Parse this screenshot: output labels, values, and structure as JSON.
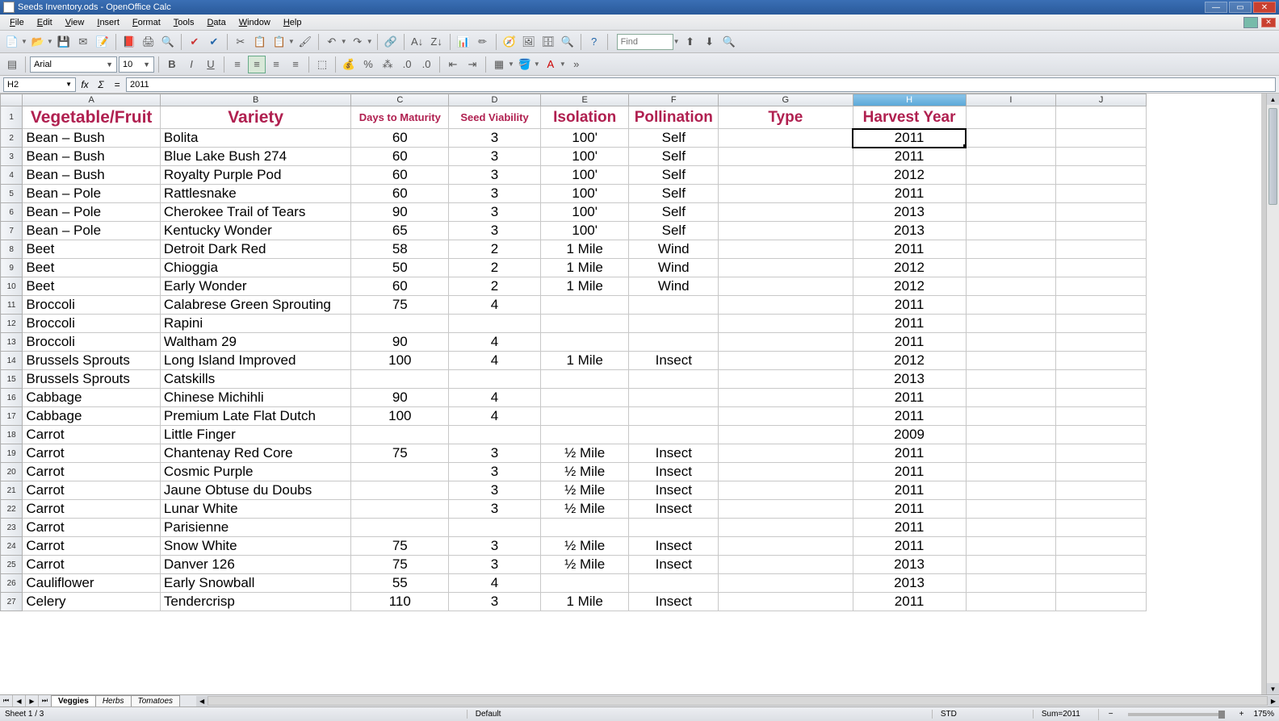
{
  "window": {
    "title": "Seeds Inventory.ods - OpenOffice Calc"
  },
  "menu": [
    "File",
    "Edit",
    "View",
    "Insert",
    "Format",
    "Tools",
    "Data",
    "Window",
    "Help"
  ],
  "format_bar": {
    "font_name": "Arial",
    "font_size": "10"
  },
  "formula": {
    "name_box": "H2",
    "content": "2011"
  },
  "find": {
    "placeholder": "Find"
  },
  "columns": [
    "A",
    "B",
    "C",
    "D",
    "E",
    "F",
    "G",
    "H",
    "I",
    "J"
  ],
  "selected_col": "H",
  "headers": {
    "A": "Vegetable/Fruit",
    "B": "Variety",
    "C": "Days to Maturity",
    "D": "Seed Viability",
    "E": "Isolation",
    "F": "Pollination",
    "G": "Type",
    "H": "Harvest Year"
  },
  "rows": [
    {
      "n": 2,
      "A": "Bean – Bush",
      "B": "Bolita",
      "C": "60",
      "D": "3",
      "E": "100'",
      "F": "Self",
      "G": "",
      "H": "2011"
    },
    {
      "n": 3,
      "A": "Bean – Bush",
      "B": "Blue Lake Bush 274",
      "C": "60",
      "D": "3",
      "E": "100'",
      "F": "Self",
      "G": "",
      "H": "2011"
    },
    {
      "n": 4,
      "A": "Bean – Bush",
      "B": "Royalty Purple Pod",
      "C": "60",
      "D": "3",
      "E": "100'",
      "F": "Self",
      "G": "",
      "H": "2012"
    },
    {
      "n": 5,
      "A": "Bean – Pole",
      "B": "Rattlesnake",
      "C": "60",
      "D": "3",
      "E": "100'",
      "F": "Self",
      "G": "",
      "H": "2011"
    },
    {
      "n": 6,
      "A": "Bean – Pole",
      "B": "Cherokee Trail of Tears",
      "C": "90",
      "D": "3",
      "E": "100'",
      "F": "Self",
      "G": "",
      "H": "2013"
    },
    {
      "n": 7,
      "A": "Bean – Pole",
      "B": "Kentucky Wonder",
      "C": "65",
      "D": "3",
      "E": "100'",
      "F": "Self",
      "G": "",
      "H": "2013"
    },
    {
      "n": 8,
      "A": "Beet",
      "B": "Detroit Dark Red",
      "C": "58",
      "D": "2",
      "E": "1 Mile",
      "F": "Wind",
      "G": "",
      "H": "2011"
    },
    {
      "n": 9,
      "A": "Beet",
      "B": "Chioggia",
      "C": "50",
      "D": "2",
      "E": "1 Mile",
      "F": "Wind",
      "G": "",
      "H": "2012"
    },
    {
      "n": 10,
      "A": "Beet",
      "B": "Early Wonder",
      "C": "60",
      "D": "2",
      "E": "1 Mile",
      "F": "Wind",
      "G": "",
      "H": "2012"
    },
    {
      "n": 11,
      "A": "Broccoli",
      "B": "Calabrese Green Sprouting",
      "C": "75",
      "D": "4",
      "E": "",
      "F": "",
      "G": "",
      "H": "2011"
    },
    {
      "n": 12,
      "A": "Broccoli",
      "B": "Rapini",
      "C": "",
      "D": "",
      "E": "",
      "F": "",
      "G": "",
      "H": "2011"
    },
    {
      "n": 13,
      "A": "Broccoli",
      "B": "Waltham 29",
      "C": "90",
      "D": "4",
      "E": "",
      "F": "",
      "G": "",
      "H": "2011"
    },
    {
      "n": 14,
      "A": "Brussels Sprouts",
      "B": "Long Island Improved",
      "C": "100",
      "D": "4",
      "E": "1 Mile",
      "F": "Insect",
      "G": "",
      "H": "2012"
    },
    {
      "n": 15,
      "A": "Brussels Sprouts",
      "B": "Catskills",
      "C": "",
      "D": "",
      "E": "",
      "F": "",
      "G": "",
      "H": "2013"
    },
    {
      "n": 16,
      "A": "Cabbage",
      "B": "Chinese Michihli",
      "C": "90",
      "D": "4",
      "E": "",
      "F": "",
      "G": "",
      "H": "2011"
    },
    {
      "n": 17,
      "A": "Cabbage",
      "B": "Premium Late Flat Dutch",
      "C": "100",
      "D": "4",
      "E": "",
      "F": "",
      "G": "",
      "H": "2011"
    },
    {
      "n": 18,
      "A": "Carrot",
      "B": "Little Finger",
      "C": "",
      "D": "",
      "E": "",
      "F": "",
      "G": "",
      "H": "2009"
    },
    {
      "n": 19,
      "A": "Carrot",
      "B": "Chantenay Red Core",
      "C": "75",
      "D": "3",
      "E": "½ Mile",
      "F": "Insect",
      "G": "",
      "H": "2011"
    },
    {
      "n": 20,
      "A": "Carrot",
      "B": "Cosmic Purple",
      "C": "",
      "D": "3",
      "E": "½ Mile",
      "F": "Insect",
      "G": "",
      "H": "2011"
    },
    {
      "n": 21,
      "A": "Carrot",
      "B": "Jaune Obtuse du Doubs",
      "C": "",
      "D": "3",
      "E": "½ Mile",
      "F": "Insect",
      "G": "",
      "H": "2011"
    },
    {
      "n": 22,
      "A": "Carrot",
      "B": "Lunar White",
      "C": "",
      "D": "3",
      "E": "½ Mile",
      "F": "Insect",
      "G": "",
      "H": "2011"
    },
    {
      "n": 23,
      "A": "Carrot",
      "B": "Parisienne",
      "C": "",
      "D": "",
      "E": "",
      "F": "",
      "G": "",
      "H": "2011"
    },
    {
      "n": 24,
      "A": "Carrot",
      "B": "Snow White",
      "C": "75",
      "D": "3",
      "E": "½ Mile",
      "F": "Insect",
      "G": "",
      "H": "2011"
    },
    {
      "n": 25,
      "A": "Carrot",
      "B": "Danver 126",
      "C": "75",
      "D": "3",
      "E": "½ Mile",
      "F": "Insect",
      "G": "",
      "H": "2013"
    },
    {
      "n": 26,
      "A": "Cauliflower",
      "B": "Early Snowball",
      "C": "55",
      "D": "4",
      "E": "",
      "F": "",
      "G": "",
      "H": "2013"
    },
    {
      "n": 27,
      "A": "Celery",
      "B": "Tendercrisp",
      "C": "110",
      "D": "3",
      "E": "1 Mile",
      "F": "Insect",
      "G": "",
      "H": "2011"
    }
  ],
  "tabs": {
    "list": [
      "Veggies",
      "Herbs",
      "Tomatoes"
    ],
    "active": 0
  },
  "status": {
    "sheet": "Sheet 1 / 3",
    "style": "Default",
    "mode": "STD",
    "sum": "Sum=2011",
    "zoom": "175%"
  }
}
